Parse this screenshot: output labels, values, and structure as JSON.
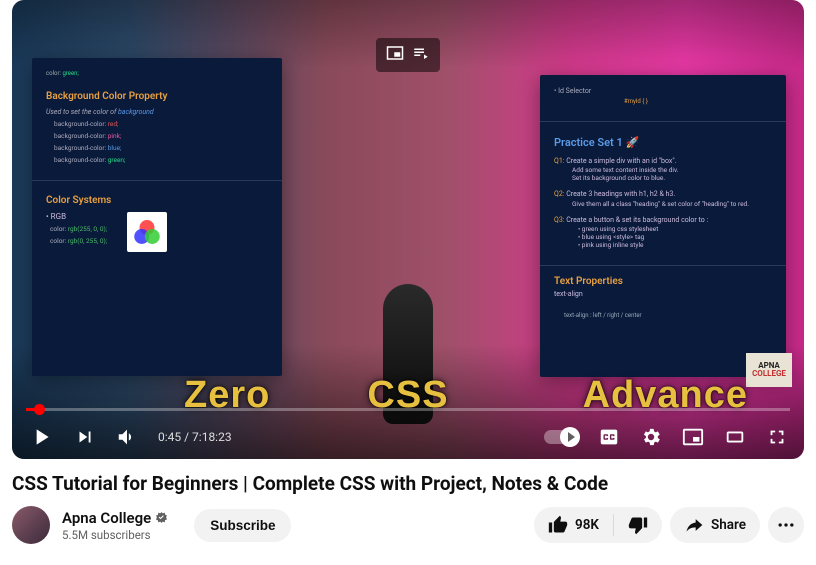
{
  "video": {
    "title": "CSS Tutorial for Beginners | Complete CSS with Project, Notes & Code",
    "current_time": "0:45",
    "total_time": "7:18:23"
  },
  "channel": {
    "name": "Apna College",
    "subscribers": "5.5M subscribers",
    "logo_line1": "APNA",
    "logo_line2": "COLLEGE"
  },
  "buttons": {
    "subscribe": "Subscribe",
    "like_count": "98K",
    "share": "Share"
  },
  "big_text": {
    "zero": "Zero",
    "css": "CSS",
    "advance": "Advance"
  },
  "slide_left": {
    "top_snippet": "color:",
    "top_val": "green;",
    "heading1": "Background Color Property",
    "desc1_a": "Used to set the color of ",
    "desc1_b": "background",
    "p1": "background-color:",
    "p1v": "red;",
    "p2": "background-color:",
    "p2v": "pink;",
    "p3": "background-color:",
    "p3v": "blue;",
    "p4": "background-color:",
    "p4v": "green;",
    "heading2": "Color Systems",
    "rgb_label": "• RGB",
    "c1": "color:",
    "c1v": "rgb(255, 0, 0);",
    "c2": "color:",
    "c2v": "rgb(0, 255, 0);"
  },
  "slide_right": {
    "id_selector": "• Id Selector",
    "id_code": "#myId { }",
    "ps_title": "Practice Set 1 🚀",
    "q1_num": "Q1:",
    "q1_a": "Create a simple div with an id \"box\".",
    "q1_b": "Add some text content inside the div.",
    "q1_c": "Set its background color to blue.",
    "q2_num": "Q2:",
    "q2_a": "Create 3 headings with h1, h2 & h3.",
    "q2_b": "Give them all a class \"heading\" & set color of \"heading\" to red.",
    "q3_num": "Q3:",
    "q3_a": "Create a button & set its background color to :",
    "q3_b1": "• green using css stylesheet",
    "q3_b2": "• blue using <style> tag",
    "q3_b3": "• pink using inline style",
    "tp_title": "Text Properties",
    "tp_sub": "text-align",
    "ta_line": "text-align : left / right / center"
  }
}
